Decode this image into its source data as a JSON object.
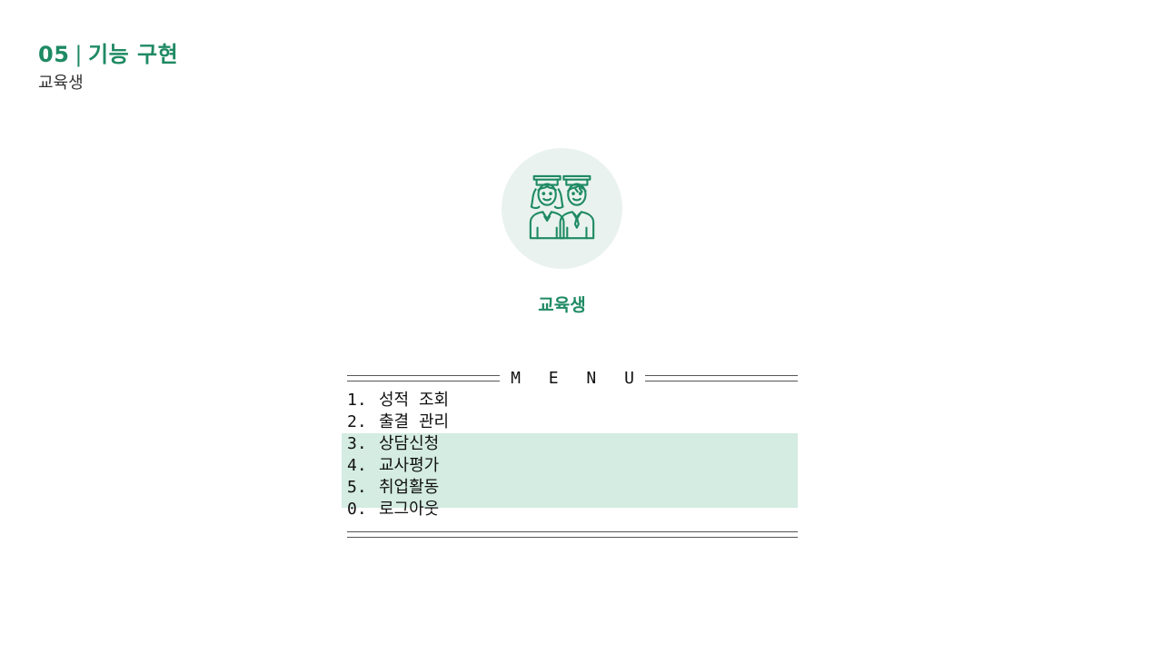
{
  "header": {
    "section_number": "05",
    "separator": "|",
    "section_title": "기능 구현",
    "subtitle": "교육생"
  },
  "role_card": {
    "icon": "graduates-icon",
    "label": "교육생"
  },
  "console_menu": {
    "title": "M E N U",
    "highlight_color": "#d4ece2",
    "items": [
      {
        "number": "1.",
        "label": "성적 조회",
        "highlighted": false
      },
      {
        "number": "2.",
        "label": "출결 관리",
        "highlighted": false
      },
      {
        "number": "3.",
        "label": "상담신청",
        "highlighted": true
      },
      {
        "number": "4.",
        "label": "교사평가",
        "highlighted": true
      },
      {
        "number": "5.",
        "label": "취업활동",
        "highlighted": true
      },
      {
        "number": "0.",
        "label": "로그아웃",
        "highlighted": false
      }
    ]
  },
  "colors": {
    "accent": "#1f8a64",
    "icon_bg": "#e9f2ee"
  }
}
